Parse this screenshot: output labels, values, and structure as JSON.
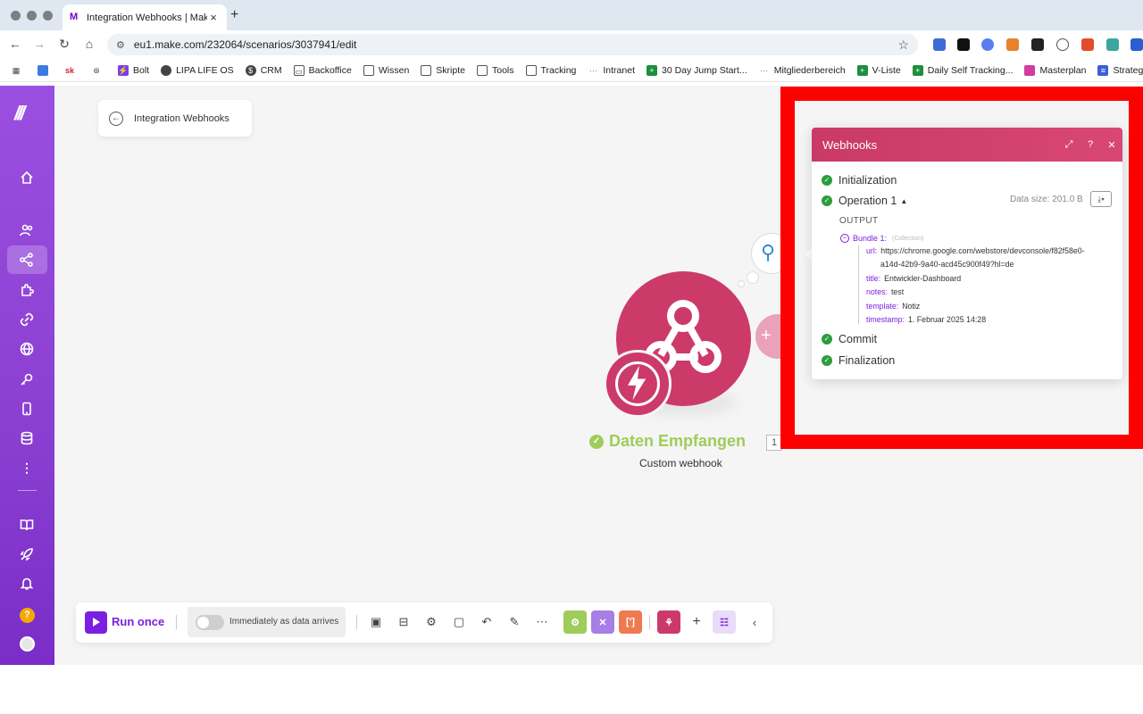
{
  "browser": {
    "tab_title": "Integration Webhooks | Make",
    "url": "eu1.make.com/232064/scenarios/3037941/edit",
    "bookmarks": [
      "Bolt",
      "LIPA LIFE OS",
      "CRM",
      "Backoffice",
      "Wissen",
      "Skripte",
      "Tools",
      "Tracking",
      "Intranet",
      "30 Day Jump Start...",
      "Mitgliederbereich",
      "V-Liste",
      "Daily Self Tracking...",
      "Masterplan",
      "Strategie + M"
    ]
  },
  "scenario": {
    "back_label": "Integration Webhooks"
  },
  "module": {
    "title": "Daten Empfangen",
    "count": "1",
    "subtitle": "Custom webhook"
  },
  "toolbar": {
    "run_label": "Run once",
    "schedule_label": "Immediately as data arrives"
  },
  "panel": {
    "title": "Webhooks",
    "phases": {
      "init": "Initialization",
      "operation": "Operation 1",
      "commit": "Commit",
      "finalization": "Finalization"
    },
    "data_size": "Data size: 201.0 B",
    "output_label": "OUTPUT",
    "bundle_label": "Bundle 1:",
    "bundle_type": "(Collection)",
    "fields": {
      "url_key": "url:",
      "url_val_1": "https://chrome.google.com/webstore/devconsole/f82f58e0-",
      "url_val_2": "a14d-42b9-9a40-acd45c900f49?hl=de",
      "title_key": "title:",
      "title_val": "Entwickler-Dashboard",
      "notes_key": "notes:",
      "notes_val": "test",
      "template_key": "template:",
      "template_val": "Notiz",
      "timestamp_key": "timestamp:",
      "timestamp_val": "1. Februar 2025 14:28"
    }
  },
  "colors": {
    "make_purple": "#7b1fe0",
    "webhook_pink": "#cc3a6a",
    "success_green": "#9fcc5a",
    "highlight_red": "#ff0000"
  },
  "icons": [
    "home-icon",
    "team-icon",
    "share-icon",
    "puzzle-icon",
    "link-icon",
    "globe-icon",
    "key-icon",
    "mobile-icon",
    "database-icon",
    "more-icon",
    "book-icon",
    "rocket-icon",
    "bell-icon",
    "help-icon",
    "webhook-icon",
    "search-icon"
  ]
}
